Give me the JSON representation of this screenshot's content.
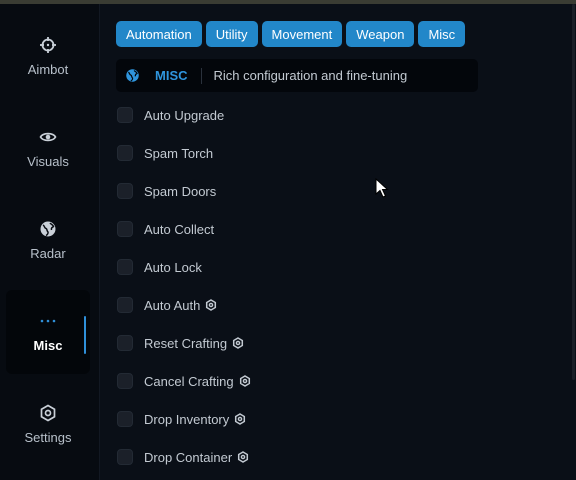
{
  "sidebar": {
    "items": [
      {
        "label": "Aimbot",
        "icon": "crosshair-icon",
        "active": false
      },
      {
        "label": "Visuals",
        "icon": "eye-icon",
        "active": false
      },
      {
        "label": "Radar",
        "icon": "globe-icon",
        "active": false
      },
      {
        "label": "Misc",
        "icon": "dots-icon",
        "active": true
      },
      {
        "label": "Settings",
        "icon": "gear-icon",
        "active": false
      }
    ]
  },
  "tabs": [
    {
      "label": "Automation"
    },
    {
      "label": "Utility"
    },
    {
      "label": "Movement"
    },
    {
      "label": "Weapon"
    },
    {
      "label": "Misc"
    }
  ],
  "header": {
    "section": "MISC",
    "description": "Rich configuration and fine-tuning",
    "icon": "globe-icon"
  },
  "options": [
    {
      "label": "Auto Upgrade",
      "checked": false,
      "has_settings": false
    },
    {
      "label": "Spam Torch",
      "checked": false,
      "has_settings": false
    },
    {
      "label": "Spam Doors",
      "checked": false,
      "has_settings": false
    },
    {
      "label": "Auto Collect",
      "checked": false,
      "has_settings": false
    },
    {
      "label": "Auto Lock",
      "checked": false,
      "has_settings": false
    },
    {
      "label": "Auto Auth",
      "checked": false,
      "has_settings": true
    },
    {
      "label": "Reset Crafting",
      "checked": false,
      "has_settings": true
    },
    {
      "label": "Cancel Crafting",
      "checked": false,
      "has_settings": true
    },
    {
      "label": "Drop Inventory",
      "checked": false,
      "has_settings": true
    },
    {
      "label": "Drop Container",
      "checked": false,
      "has_settings": true
    }
  ],
  "colors": {
    "accent": "#2287c9",
    "accent_text": "#2f95de",
    "background": "#0a0f17",
    "sidebar": "#070b11"
  }
}
